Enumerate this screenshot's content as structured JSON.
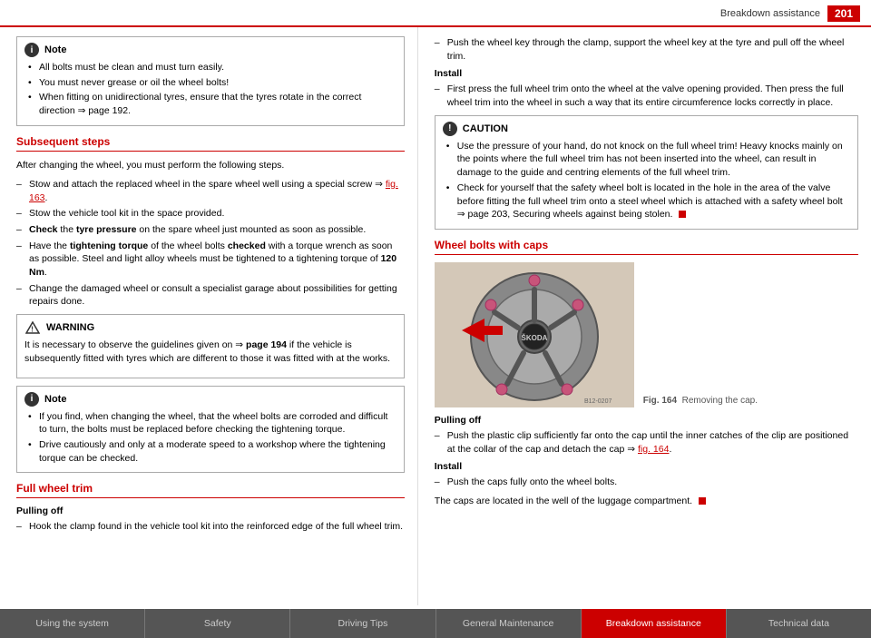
{
  "header": {
    "title": "Breakdown assistance",
    "page_number": "201"
  },
  "left_column": {
    "note1": {
      "label": "Note",
      "items": [
        "All bolts must be clean and must turn easily.",
        "You must never grease or oil the wheel bolts!",
        "When fitting on unidirectional tyres, ensure that the tyres rotate in the correct direction ⇒ page 192."
      ]
    },
    "subsequent_steps": {
      "heading": "Subsequent steps",
      "intro": "After changing the wheel, you must perform the following steps.",
      "steps": [
        "Stow and attach the replaced wheel in the spare wheel well using a special screw ⇒ fig. 163.",
        "Stow the vehicle tool kit in the space provided.",
        "Check the tyre pressure on the spare wheel just mounted as soon as possible.",
        "Have the tightening torque of the wheel bolts checked with a torque wrench as soon as possible. Steel and light alloy wheels must be tightened to a tightening torque of 120 Nm.",
        "Change the damaged wheel or consult a specialist garage about possibilities for getting repairs done."
      ]
    },
    "warning": {
      "label": "WARNING",
      "text": "It is necessary to observe the guidelines given on ⇒ page 194 if the vehicle is subsequently fitted with tyres which are different to those it was fitted with at the works."
    },
    "note2": {
      "label": "Note",
      "items": [
        "If you find, when changing the wheel, that the wheel bolts are corroded and difficult to turn, the bolts must be replaced before checking the tightening torque.",
        "Drive cautiously and only at a moderate speed to a workshop where the tightening torque can be checked."
      ]
    },
    "full_wheel_trim": {
      "heading": "Full wheel trim",
      "pulling_off_label": "Pulling off",
      "steps": [
        "Hook the clamp found in the vehicle tool kit into the reinforced edge of the full wheel trim."
      ]
    }
  },
  "right_column": {
    "continued_steps": [
      "Push the wheel key through the clamp, support the wheel key at the tyre and pull off the wheel trim."
    ],
    "install_label": "Install",
    "install_steps": [
      "First press the full wheel trim onto the wheel at the valve opening provided. Then press the full wheel trim into the wheel in such a way that its entire circumference locks correctly in place."
    ],
    "caution": {
      "label": "CAUTION",
      "items": [
        "Use the pressure of your hand, do not knock on the full wheel trim! Heavy knocks mainly on the points where the full wheel trim has not been inserted into the wheel, can result in damage to the guide and centring elements of the full wheel trim.",
        "Check for yourself that the safety wheel bolt is located in the hole in the area of the valve before fitting the full wheel trim onto a steel wheel which is attached with a safety wheel bolt ⇒ page 203, Securing wheels against being stolen."
      ]
    },
    "wheel_bolts_heading": "Wheel bolts with caps",
    "fig_label": "Fig. 164",
    "fig_caption": "Removing the cap.",
    "fig_code": "B12-0207",
    "pulling_off_label": "Pulling off",
    "pulling_off_steps": [
      "Push the plastic clip sufficiently far onto the cap until the inner catches of the clip are positioned at the collar of the cap and detach the cap ⇒ fig. 164."
    ],
    "install2_label": "Install",
    "install2_steps": [
      "Push the caps fully onto the wheel bolts."
    ],
    "caps_location": "The caps are located in the well of the luggage compartment."
  },
  "footer": {
    "nav_items": [
      {
        "label": "Using the system",
        "active": false
      },
      {
        "label": "Safety",
        "active": false
      },
      {
        "label": "Driving Tips",
        "active": false
      },
      {
        "label": "General Maintenance",
        "active": false
      },
      {
        "label": "Breakdown assistance",
        "active": true
      },
      {
        "label": "Technical data",
        "active": false
      }
    ]
  }
}
